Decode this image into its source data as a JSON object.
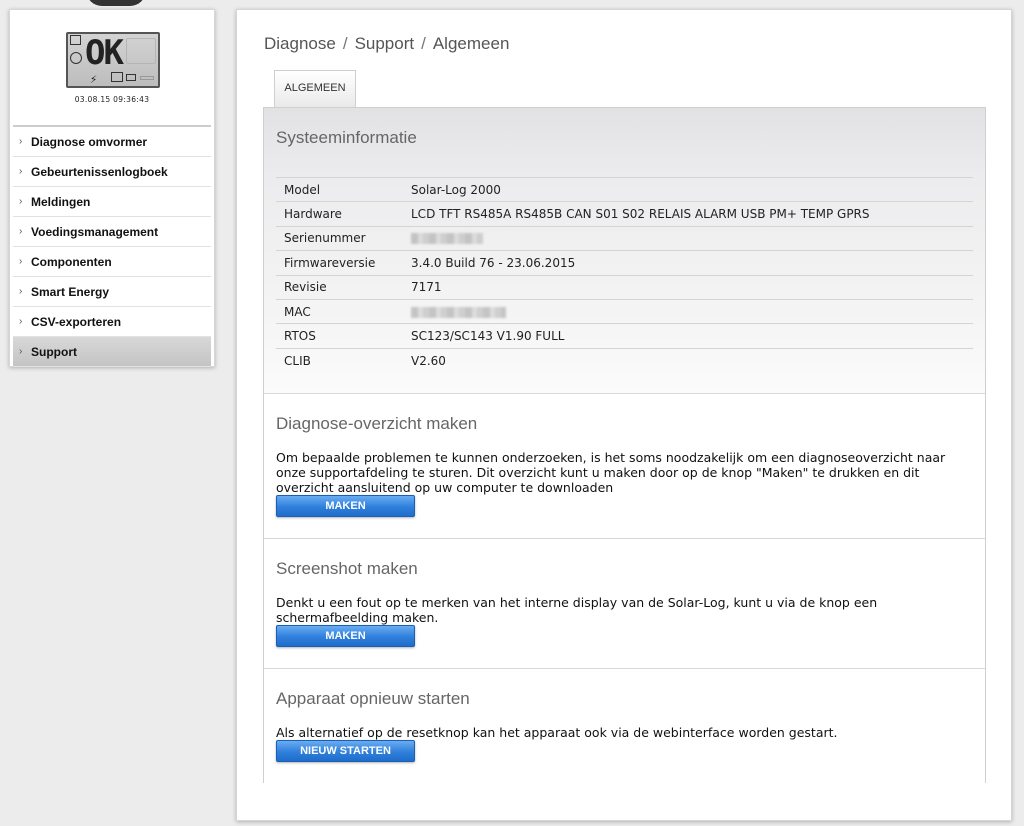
{
  "device": {
    "display_text": "OK",
    "datetime": "03.08.15 09:36:43"
  },
  "sidebar": {
    "items": [
      {
        "label": "Diagnose omvormer"
      },
      {
        "label": "Gebeurtenissenlogboek"
      },
      {
        "label": "Meldingen"
      },
      {
        "label": "Voedingsmanagement"
      },
      {
        "label": "Componenten"
      },
      {
        "label": "Smart Energy"
      },
      {
        "label": "CSV-exporteren"
      },
      {
        "label": "Support",
        "active": true
      }
    ]
  },
  "breadcrumb": [
    "Diagnose",
    "Support",
    "Algemeen"
  ],
  "tabs": [
    {
      "label": "ALGEMEEN",
      "active": true
    }
  ],
  "system_info": {
    "title": "Systeeminformatie",
    "rows": [
      {
        "label": "Model",
        "value": "Solar-Log 2000"
      },
      {
        "label": "Hardware",
        "value": "LCD TFT RS485A RS485B CAN S01 S02 RELAIS ALARM USB PM+ TEMP GPRS"
      },
      {
        "label": "Serienummer",
        "value": ""
      },
      {
        "label": "Firmwareversie",
        "value": "3.4.0 Build 76 - 23.06.2015"
      },
      {
        "label": "Revisie",
        "value": "7171"
      },
      {
        "label": "MAC",
        "value": ""
      },
      {
        "label": "RTOS",
        "value": "SC123/SC143 V1.90 FULL"
      },
      {
        "label": "CLIB",
        "value": "V2.60"
      }
    ]
  },
  "diagnose": {
    "title": "Diagnose-overzicht maken",
    "description": "Om bepaalde problemen te kunnen onderzoeken, is het soms noodzakelijk om een diagnoseoverzicht naar onze supportafdeling te sturen. Dit overzicht kunt u maken door op de knop \"Maken\" te drukken en dit overzicht aansluitend op uw computer te downloaden",
    "button": "MAKEN"
  },
  "screenshot": {
    "title": "Screenshot maken",
    "description": "Denkt u een fout op te merken van het interne display van de Solar-Log, kunt u via de knop een schermafbeelding maken.",
    "button": "MAKEN"
  },
  "restart": {
    "title": "Apparaat opnieuw starten",
    "description": "Als alternatief op de resetknop kan het apparaat ook via de webinterface worden gestart.",
    "button": "NIEUW STARTEN"
  },
  "colors": {
    "button_blue": "#2f7fdb",
    "active_nav": "#c8c8c8"
  }
}
